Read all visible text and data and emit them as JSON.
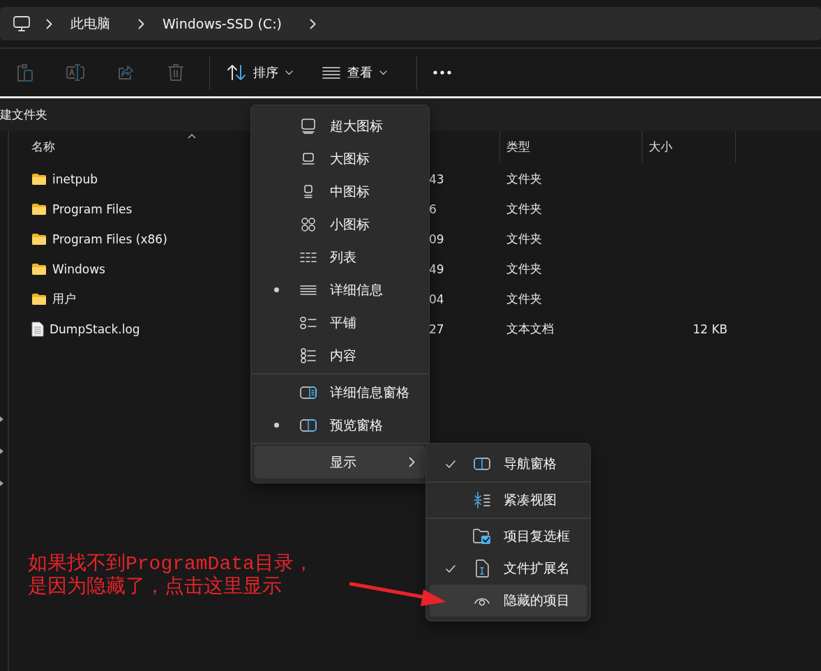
{
  "breadcrumb": [
    "此电脑",
    "Windows-SSD (C:)"
  ],
  "toolbar": {
    "icon_buttons": [
      {
        "kind": "paste",
        "disabled": true
      },
      {
        "kind": "rename",
        "disabled": true
      },
      {
        "kind": "share",
        "disabled": true
      },
      {
        "kind": "delete",
        "disabled": true
      }
    ],
    "dropdowns": [
      {
        "kind": "sort",
        "label": "排序"
      },
      {
        "kind": "view",
        "label": "查看"
      }
    ]
  },
  "new_item_strip": "建文件夹",
  "columns": [
    "名称",
    "类型",
    "大小"
  ],
  "rows": [
    {
      "kind": "folder",
      "name": "inetpub",
      "column_2": "43",
      "type": "文件夹"
    },
    {
      "kind": "folder",
      "name": "Program Files",
      "column_2": "6",
      "type": "文件夹"
    },
    {
      "kind": "folder",
      "name": "Program Files (x86)",
      "column_2": "09",
      "type": "文件夹"
    },
    {
      "kind": "folder",
      "name": "Windows",
      "column_2": "49",
      "type": "文件夹"
    },
    {
      "kind": "folder",
      "name": "用户",
      "column_2": "04",
      "type": "文件夹"
    },
    {
      "kind": "file",
      "name": "DumpStack.log",
      "column_2": "27",
      "type": "文本文档",
      "size": "12 KB"
    }
  ],
  "view_menu": {
    "sections": [
      {
        "items": [
          {
            "kind": "extra_large",
            "label": "超大图标",
            "selected": false,
            "highlighted": false
          },
          {
            "kind": "large",
            "label": "大图标",
            "selected": false,
            "highlighted": false
          },
          {
            "kind": "medium",
            "label": "中图标",
            "selected": false,
            "highlighted": false
          },
          {
            "kind": "small",
            "label": "小图标",
            "selected": false,
            "highlighted": false
          },
          {
            "kind": "list",
            "label": "列表",
            "selected": false,
            "highlighted": false
          },
          {
            "kind": "details",
            "label": "详细信息",
            "selected": true,
            "highlighted": false
          },
          {
            "kind": "tiles",
            "label": "平铺",
            "selected": false,
            "highlighted": false
          },
          {
            "kind": "content",
            "label": "内容",
            "selected": false,
            "highlighted": false
          }
        ]
      },
      {
        "items": [
          {
            "kind": "details_pane",
            "label": "详细信息窗格",
            "selected": false,
            "highlighted": false
          },
          {
            "kind": "preview_pane",
            "label": "预览窗格",
            "selected": true,
            "highlighted": false
          }
        ]
      },
      {
        "items": [
          {
            "kind": "submenu",
            "label": "显示",
            "selected": false,
            "highlighted": true
          }
        ]
      }
    ]
  },
  "show_menu": {
    "sections": [
      {
        "items": [
          {
            "kind": "nav_pane",
            "label": "导航窗格",
            "checked": true,
            "highlighted": false
          }
        ]
      },
      {
        "items": [
          {
            "kind": "compact",
            "label": "紧凑视图",
            "checked": false,
            "highlighted": false
          }
        ]
      },
      {
        "items": [
          {
            "kind": "checkboxes",
            "label": "项目复选框",
            "checked": false,
            "highlighted": false
          },
          {
            "kind": "extensions",
            "label": "文件扩展名",
            "checked": true,
            "highlighted": false
          },
          {
            "kind": "hidden",
            "label": "隐藏的项目",
            "checked": false,
            "highlighted": true
          }
        ]
      }
    ]
  },
  "annotation": {
    "color": "#e8232a",
    "lines": [
      "如果找不到ProgramData目录，",
      "是因为隐藏了，点击这里显示"
    ]
  }
}
